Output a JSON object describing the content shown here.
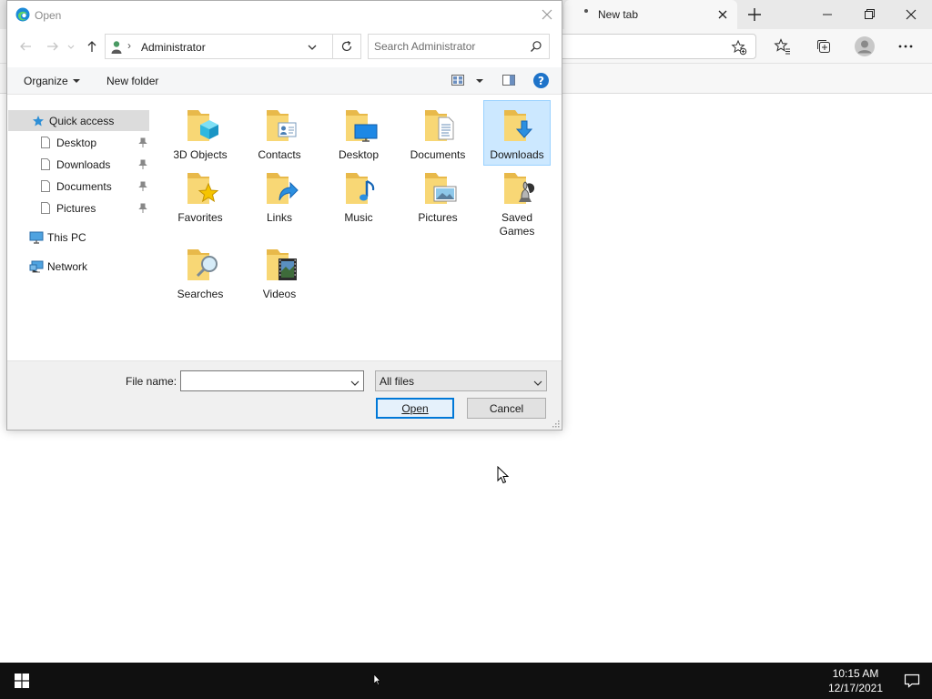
{
  "browser": {
    "tab_title": "New tab",
    "icons": {
      "new_tab": "plus-icon",
      "minimize": "minimize-icon",
      "restore": "restore-icon",
      "close": "close-icon",
      "add_favorite": "star-plus-icon",
      "favorites": "favorites-icon",
      "collections": "collections-icon",
      "profile": "profile-icon",
      "menu": "more-icon"
    }
  },
  "dialog": {
    "title": "Open",
    "breadcrumb": {
      "location": "Administrator"
    },
    "search": {
      "placeholder": "Search Administrator"
    },
    "commands": {
      "organize": "Organize",
      "new_folder": "New folder"
    },
    "help_label": "?",
    "nav_pane": {
      "quick_access": "Quick access",
      "pinned": [
        "Desktop",
        "Downloads",
        "Documents",
        "Pictures"
      ],
      "this_pc": "This PC",
      "network": "Network"
    },
    "folders": [
      {
        "label": "3D Objects",
        "icon": "3d-objects-folder-icon"
      },
      {
        "label": "Contacts",
        "icon": "contacts-folder-icon"
      },
      {
        "label": "Desktop",
        "icon": "desktop-folder-icon"
      },
      {
        "label": "Documents",
        "icon": "documents-folder-icon"
      },
      {
        "label": "Downloads",
        "icon": "downloads-folder-icon",
        "selected": true
      },
      {
        "label": "Favorites",
        "icon": "favorites-folder-icon"
      },
      {
        "label": "Links",
        "icon": "links-folder-icon"
      },
      {
        "label": "Music",
        "icon": "music-folder-icon"
      },
      {
        "label": "Pictures",
        "icon": "pictures-folder-icon"
      },
      {
        "label": "Saved Games",
        "icon": "saved-games-folder-icon"
      },
      {
        "label": "Searches",
        "icon": "searches-folder-icon"
      },
      {
        "label": "Videos",
        "icon": "videos-folder-icon"
      }
    ],
    "file_name": {
      "label": "File name:",
      "value": ""
    },
    "file_type": {
      "selected": "All files"
    },
    "buttons": {
      "open": "Open",
      "cancel": "Cancel"
    }
  },
  "taskbar": {
    "time": "10:15 AM",
    "date": "12/17/2021"
  },
  "colors": {
    "accent": "#0078d7",
    "selection": "#cce8ff",
    "folder_yellow": "#f8d775",
    "taskbar": "#101010"
  }
}
